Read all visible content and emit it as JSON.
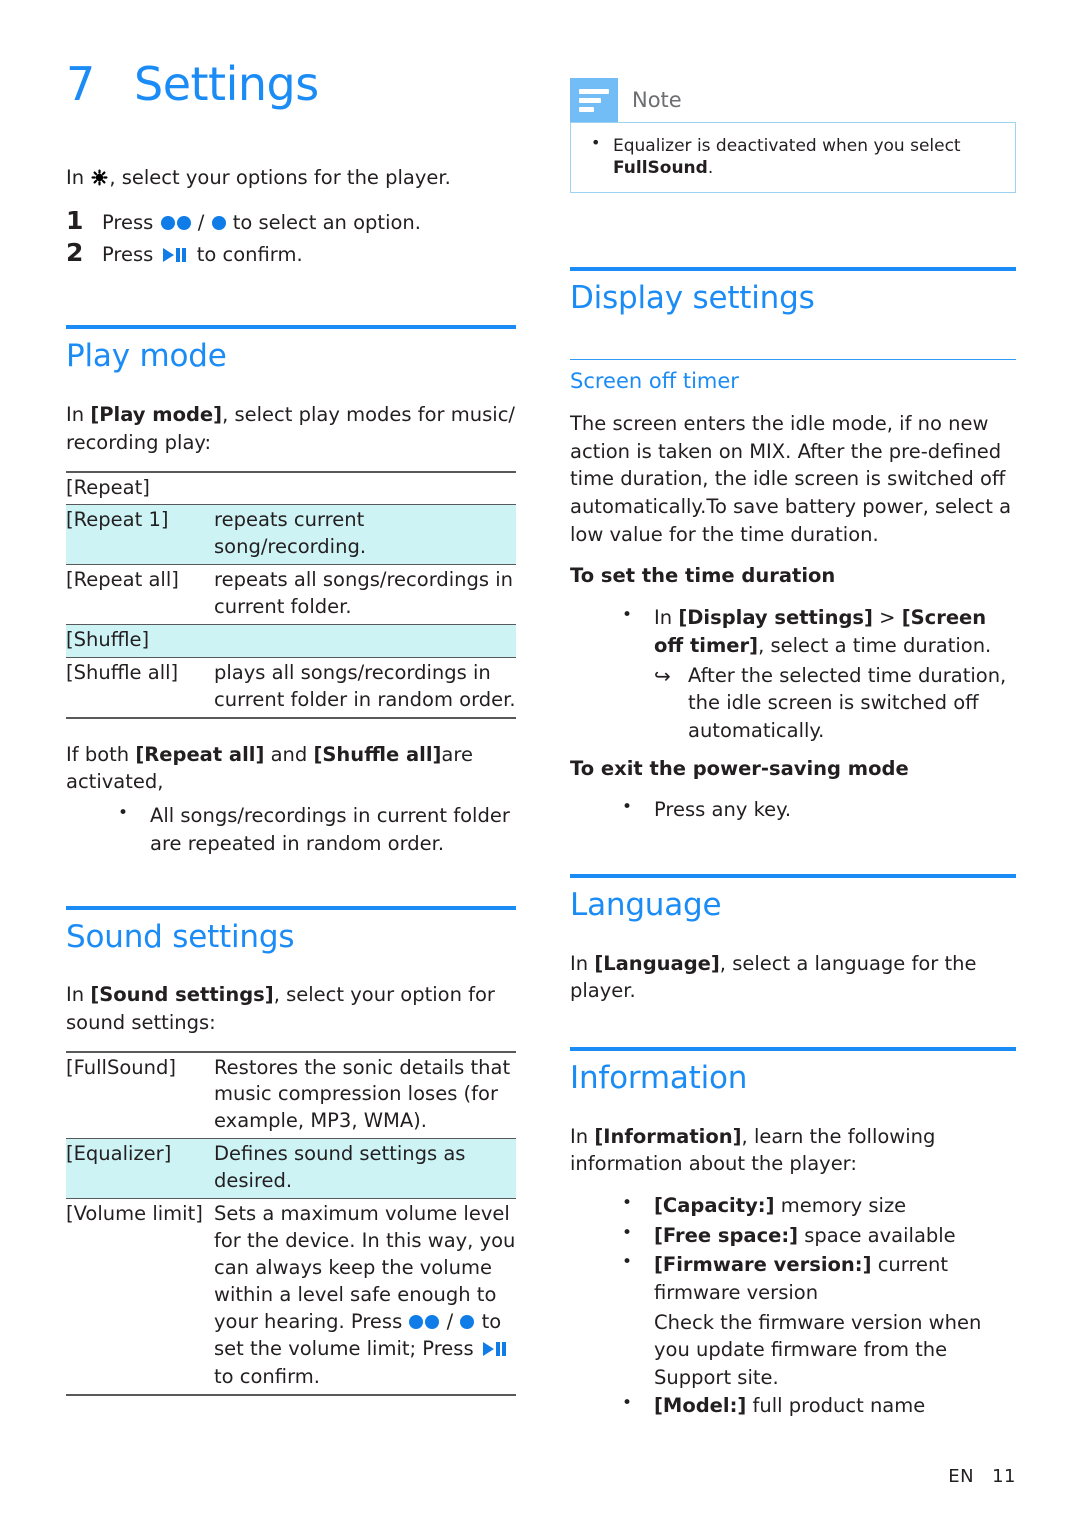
{
  "document": {
    "chapter_number": "7",
    "chapter_title": "Settings",
    "footer_lang": "EN",
    "footer_page": "11"
  },
  "colors": {
    "accent_blue": "#1b8cf5",
    "icon_blue": "#0f7ce8",
    "highlight_cyan": "#cdf3f5",
    "note_icon_blue": "#73bdf7",
    "note_border": "#9bd3f0",
    "rule_gray": "#58595b",
    "text": "#231f20"
  },
  "intro": {
    "lead_pre": "In ",
    "lead_post": ", select your options for the player.",
    "gear_icon": "gear-icon",
    "steps": [
      {
        "number": "1",
        "pre": "Press ",
        "mid": " / ",
        "post": " to select an option.",
        "icons": [
          "circle-button-icon",
          "circle-button-icon",
          "circle-button-icon"
        ]
      },
      {
        "number": "2",
        "pre": "Press ",
        "post": " to confirm.",
        "icons": [
          "play-pause-icon"
        ]
      }
    ]
  },
  "play_mode": {
    "heading": "Play mode",
    "intro_pre": "In ",
    "intro_bold": "[Play mode]",
    "intro_post": ", select play modes for music/ recording play:",
    "table": [
      {
        "key": "[Repeat]",
        "value": "",
        "highlight": false,
        "span": true
      },
      {
        "key": "[Repeat 1]",
        "value": "repeats current song/recording.",
        "highlight": true,
        "span": false
      },
      {
        "key": "[Repeat all]",
        "value": "repeats all songs/recordings in current folder.",
        "highlight": false,
        "span": false
      },
      {
        "key": "[Shuffle]",
        "value": "",
        "highlight": true,
        "span": true
      },
      {
        "key": "[Shuffle all]",
        "value": "plays all songs/recordings in current folder in random order.",
        "highlight": false,
        "span": false
      }
    ],
    "note_pre": "If both ",
    "note_b1": "[Repeat all]",
    "note_mid": " and ",
    "note_b2": "[Shuffle all]",
    "note_post": "are activated,",
    "note_bullet": "All songs/recordings in current folder are repeated in random order."
  },
  "sound_settings": {
    "heading": "Sound settings",
    "intro_pre": " In ",
    "intro_bold": "[Sound settings]",
    "intro_post": ", select your option for sound settings:",
    "table": [
      {
        "key": "[FullSound]",
        "value": "Restores the sonic details that music compression loses (for example, MP3, WMA).",
        "highlight": false
      },
      {
        "key": "[Equalizer]",
        "value": "Defines sound settings as desired.",
        "highlight": true
      },
      {
        "key": "[Volume limit]",
        "value_part1": "Sets a maximum volume level for the device. In this way, you can always keep the volume within a level safe enough to your hearing. Press ",
        "value_mid": " / ",
        "value_part2": " to set the volume limit; Press ",
        "value_part3": " to confirm.",
        "highlight": false,
        "icons": [
          "circle-button-icon",
          "circle-button-icon",
          "circle-button-icon",
          "play-pause-icon"
        ]
      }
    ]
  },
  "note_box": {
    "label": "Note",
    "icon": "note-lines-icon",
    "items_pre": "Equalizer is deactivated when you select ",
    "items_bold": "FullSound",
    "items_post": "."
  },
  "display_settings": {
    "heading": "Display settings",
    "subsection": "Screen off timer",
    "paragraph_1": "The screen enters the idle mode, if no new action is taken on MIX. After the pre-defined time duration, the idle screen is switched off automatically.To save battery power, select a low value for the time duration.",
    "to_set_heading": "To set the time duration",
    "bullet_pre": "In ",
    "bullet_b1": "[Display settings]",
    "bullet_mid": " > ",
    "bullet_b2": "[Screen off timer]",
    "bullet_post": ", select a time duration.",
    "arrow_item": "After the selected time duration, the idle screen is switched off automatically.",
    "to_exit_heading": "To exit the power-saving mode",
    "exit_bullet": "Press any key."
  },
  "language": {
    "heading": "Language",
    "intro_pre": "In ",
    "intro_bold": "[Language]",
    "intro_post": ", select a language for the player."
  },
  "information": {
    "heading": "Information",
    "intro_pre": "In ",
    "intro_bold": "[Information]",
    "intro_post": ", learn the following information about the player:",
    "items": [
      {
        "bold": "[Capacity:]",
        "rest": " memory size"
      },
      {
        "bold": "[Free space:]",
        "rest": " space available"
      },
      {
        "bold": "[Firmware version:]",
        "rest": " current firmware version"
      },
      {
        "bold": "[Model:]",
        "rest": " full product name"
      }
    ],
    "firmware_note": "Check the firmware version when you update firmware from the Support site."
  }
}
